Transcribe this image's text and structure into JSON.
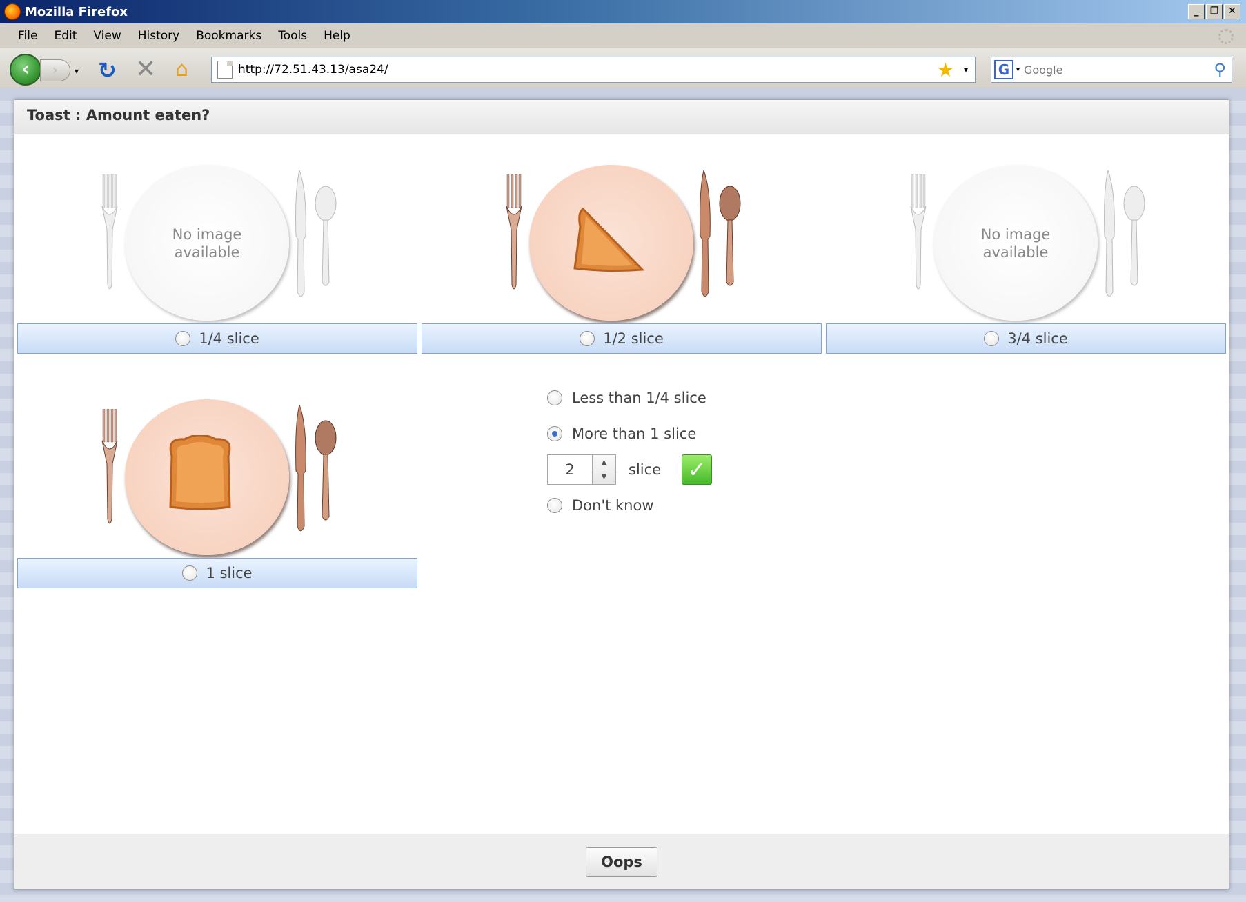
{
  "window": {
    "title": "Mozilla Firefox"
  },
  "window_controls": {
    "minimize": "_",
    "restore": "❐",
    "close": "✕"
  },
  "menu": [
    "File",
    "Edit",
    "View",
    "History",
    "Bookmarks",
    "Tools",
    "Help"
  ],
  "toolbar": {
    "back_symbol": "‹",
    "forward_symbol": "›",
    "reload_symbol": "↻",
    "stop_symbol": "✕",
    "home_symbol": "⌂",
    "dropdown_symbol": "▾",
    "bookmark_star": "★",
    "url": "http://72.51.43.13/asa24/",
    "search_engine_letter": "G",
    "search_placeholder": "Google",
    "search_symbol": "⚲"
  },
  "dialog": {
    "title": "Toast : Amount eaten?",
    "no_image_text_1": "No image",
    "no_image_text_2": "available",
    "options": [
      {
        "label": "1/4 slice",
        "image": "none",
        "selected": false
      },
      {
        "label": "1/2 slice",
        "image": "toast-half",
        "selected": false
      },
      {
        "label": "3/4 slice",
        "image": "none",
        "selected": false
      },
      {
        "label": "1 slice",
        "image": "toast-whole",
        "selected": false
      }
    ],
    "side_options": {
      "less_than": "Less than 1/4 slice",
      "more_than": "More than 1 slice",
      "more_than_selected": true,
      "quantity_value": "2",
      "spinner_up": "▲",
      "spinner_down": "▼",
      "unit": "slice",
      "confirm_symbol": "✓",
      "dont_know": "Don't know"
    },
    "footer_button": "Oops"
  },
  "colors": {
    "option_bar": "#c8dcf6",
    "confirm_green": "#46b82b",
    "titlebar_blue": "#0a246a"
  }
}
